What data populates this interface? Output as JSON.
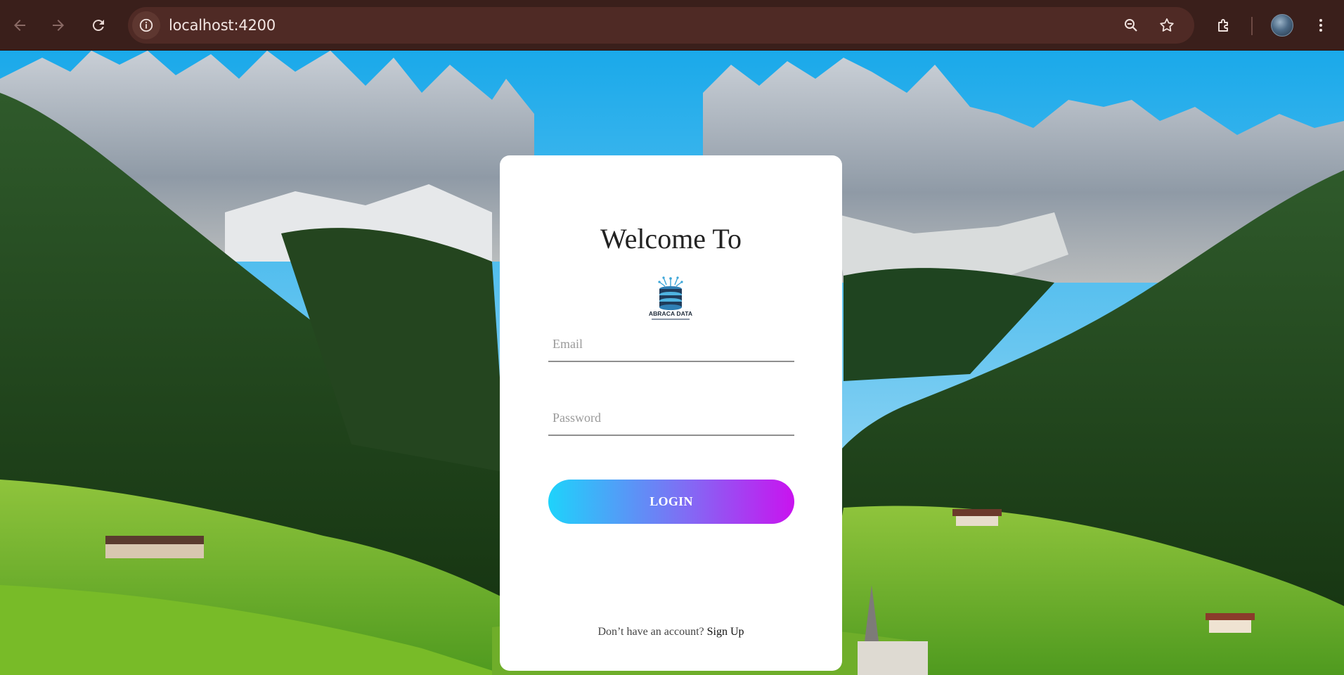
{
  "browser": {
    "url": "localhost:4200",
    "icons": {
      "back": "back-arrow-icon",
      "forward": "forward-arrow-icon",
      "reload": "reload-icon",
      "site_info": "info-icon",
      "zoom": "zoom-icon",
      "bookmark": "star-icon",
      "extensions": "puzzle-icon",
      "profile": "avatar",
      "menu": "kebab-menu-icon"
    }
  },
  "login": {
    "title": "Welcome To",
    "logo_text": "ABRACA DATA",
    "email_placeholder": "Email",
    "password_placeholder": "Password",
    "login_label": "LOGIN",
    "no_account_text": "Don’t have an account?",
    "signup_label": "Sign Up"
  },
  "colors": {
    "chrome": "#3a1f1b",
    "omnibox": "#4f2a25",
    "button_gradient_start": "#1ed3fb",
    "button_gradient_end": "#c913ef"
  }
}
